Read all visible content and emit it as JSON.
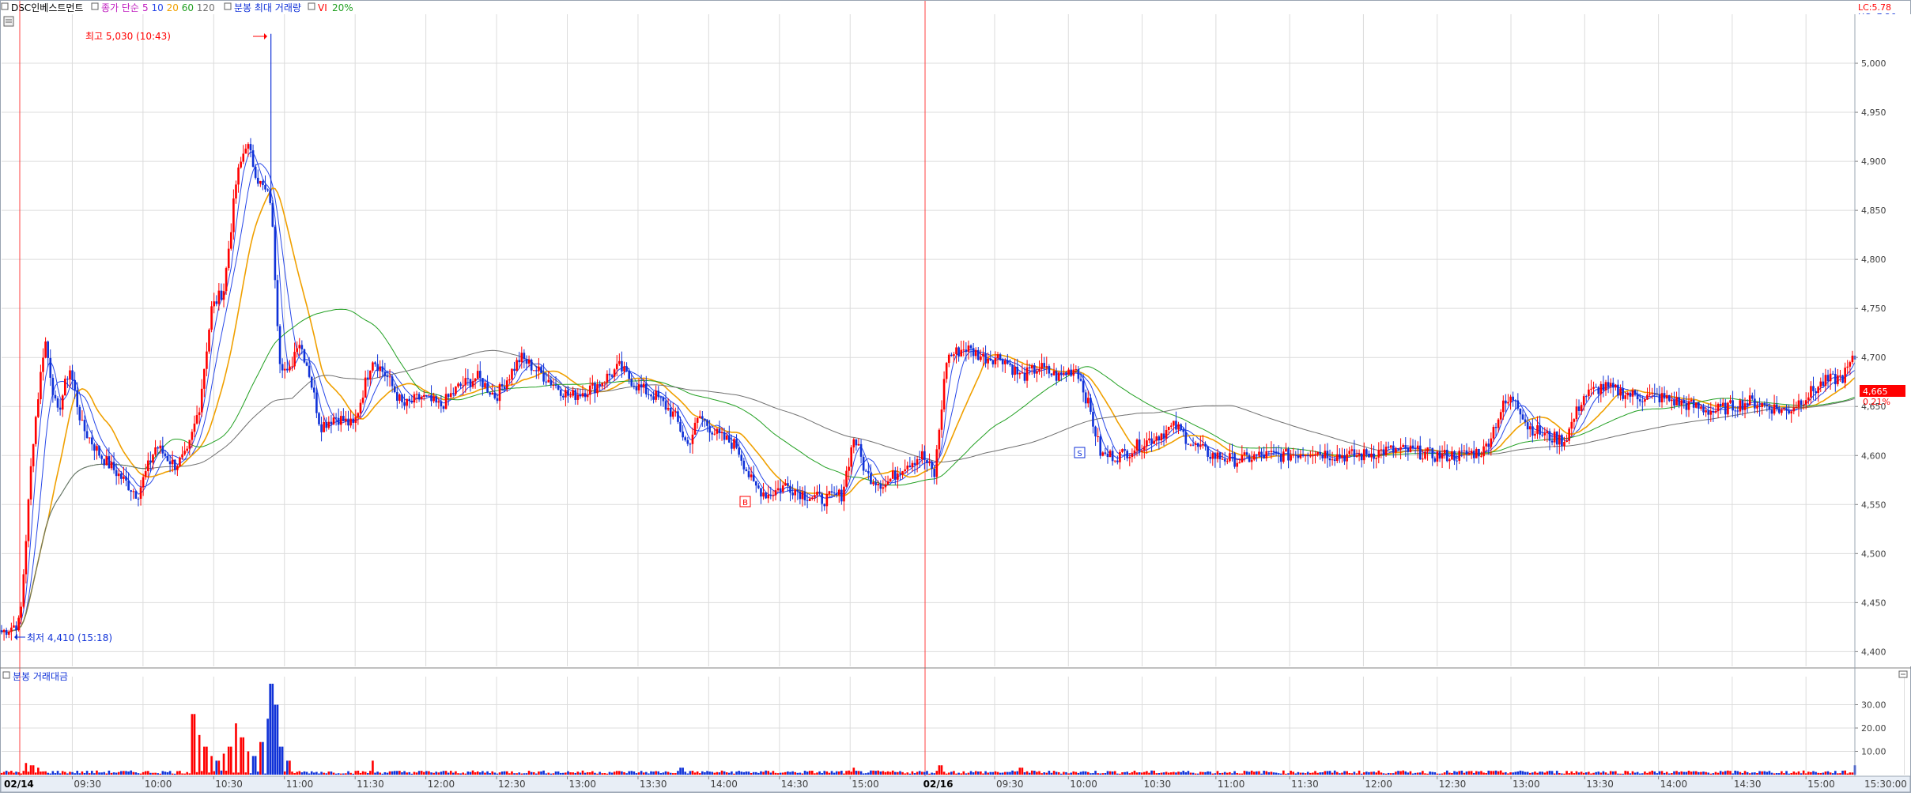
{
  "header": {
    "stock_name": "DSC인베스트먼트",
    "ma_label": "종가 단순",
    "ma_periods": [
      "5",
      "10",
      "20",
      "60",
      "120"
    ],
    "volume_label": "분봉 최대 거래량",
    "vi_label": "VI",
    "vi_value": "20%"
  },
  "right_info": {
    "lc": "LC:5.78",
    "hc": "HC:-7.26"
  },
  "colors": {
    "up": "#ff0000",
    "down": "#1032d8",
    "ma5": "#2848e8",
    "ma10": "#2848e8",
    "ma20": "#f0a000",
    "ma60": "#22a022",
    "ma120": "#707070",
    "grid": "#dcdcdc",
    "axis_bg": "#e8eef6"
  },
  "price_panel": {
    "high_annotation": "최고 5,030 (10:43)",
    "low_annotation": "최저 4,410 (15:18)",
    "current_price": "4,665",
    "current_change": "0.21%",
    "markers": [
      "B",
      "S"
    ]
  },
  "volume_panel": {
    "title": "분봉 거래대금"
  },
  "chart_data": [
    {
      "type": "candlestick",
      "title": "",
      "x_ticks": [
        "02/14",
        "09:30",
        "10:00",
        "10:30",
        "11:00",
        "11:30",
        "12:00",
        "12:30",
        "13:00",
        "13:30",
        "14:00",
        "14:30",
        "15:00",
        "02/16",
        "09:30",
        "10:00",
        "10:30",
        "11:00",
        "11:30",
        "12:00",
        "12:30",
        "13:00",
        "13:30",
        "14:00",
        "14:30",
        "15:00",
        "15:30:00"
      ],
      "y_ticks": [
        "5,000",
        "4,950",
        "4,900",
        "4,850",
        "4,800",
        "4,750",
        "4,700",
        "4,650",
        "4,600",
        "4,550",
        "4,500",
        "4,450",
        "4,400"
      ],
      "ylim": [
        4385,
        5050
      ],
      "grid": true,
      "price_path": [
        [
          0,
          4420
        ],
        [
          15,
          4430
        ],
        [
          25,
          4610
        ],
        [
          35,
          4720
        ],
        [
          45,
          4640
        ],
        [
          55,
          4690
        ],
        [
          65,
          4630
        ],
        [
          80,
          4600
        ],
        [
          95,
          4580
        ],
        [
          110,
          4560
        ],
        [
          125,
          4610
        ],
        [
          140,
          4590
        ],
        [
          150,
          4600
        ],
        [
          160,
          4650
        ],
        [
          170,
          4750
        ],
        [
          180,
          4770
        ],
        [
          190,
          4880
        ],
        [
          198,
          4920
        ],
        [
          208,
          4880
        ],
        [
          218,
          4860
        ],
        [
          225,
          4700
        ],
        [
          232,
          4680
        ],
        [
          240,
          4720
        ],
        [
          248,
          4690
        ],
        [
          258,
          4630
        ],
        [
          270,
          4640
        ],
        [
          285,
          4630
        ],
        [
          300,
          4700
        ],
        [
          312,
          4680
        ],
        [
          325,
          4650
        ],
        [
          340,
          4660
        ],
        [
          355,
          4650
        ],
        [
          370,
          4670
        ],
        [
          385,
          4680
        ],
        [
          400,
          4660
        ],
        [
          420,
          4700
        ],
        [
          440,
          4680
        ],
        [
          460,
          4660
        ],
        [
          480,
          4670
        ],
        [
          500,
          4690
        ],
        [
          515,
          4670
        ],
        [
          530,
          4660
        ],
        [
          545,
          4640
        ],
        [
          555,
          4610
        ],
        [
          565,
          4640
        ],
        [
          580,
          4620
        ],
        [
          595,
          4610
        ],
        [
          608,
          4570
        ],
        [
          620,
          4560
        ],
        [
          635,
          4570
        ],
        [
          650,
          4560
        ],
        [
          665,
          4555
        ],
        [
          680,
          4560
        ],
        [
          690,
          4620
        ],
        [
          700,
          4580
        ],
        [
          715,
          4570
        ],
        [
          730,
          4590
        ],
        [
          745,
          4600
        ],
        [
          755,
          4580
        ],
        [
          765,
          4700
        ],
        [
          780,
          4710
        ],
        [
          795,
          4700
        ],
        [
          810,
          4700
        ],
        [
          825,
          4680
        ],
        [
          840,
          4690
        ],
        [
          855,
          4680
        ],
        [
          870,
          4690
        ],
        [
          880,
          4650
        ],
        [
          890,
          4600
        ],
        [
          905,
          4600
        ],
        [
          920,
          4610
        ],
        [
          935,
          4620
        ],
        [
          950,
          4630
        ],
        [
          965,
          4610
        ],
        [
          980,
          4600
        ],
        [
          1000,
          4595
        ],
        [
          1020,
          4600
        ],
        [
          1040,
          4600
        ],
        [
          1060,
          4605
        ],
        [
          1080,
          4600
        ],
        [
          1100,
          4600
        ],
        [
          1120,
          4605
        ],
        [
          1140,
          4605
        ],
        [
          1160,
          4600
        ],
        [
          1180,
          4600
        ],
        [
          1200,
          4605
        ],
        [
          1215,
          4650
        ],
        [
          1225,
          4660
        ],
        [
          1235,
          4630
        ],
        [
          1250,
          4620
        ],
        [
          1265,
          4615
        ],
        [
          1280,
          4660
        ],
        [
          1295,
          4670
        ],
        [
          1310,
          4665
        ],
        [
          1325,
          4660
        ],
        [
          1340,
          4660
        ],
        [
          1355,
          4655
        ],
        [
          1370,
          4650
        ],
        [
          1385,
          4645
        ],
        [
          1400,
          4650
        ],
        [
          1415,
          4655
        ],
        [
          1430,
          4650
        ],
        [
          1445,
          4645
        ],
        [
          1460,
          4660
        ],
        [
          1475,
          4675
        ],
        [
          1490,
          4680
        ],
        [
          1500,
          4700
        ]
      ],
      "annotations": [
        "최고 5,030 (10:43)",
        "최저 4,410 (15:18)"
      ]
    },
    {
      "type": "bar",
      "title": "분봉 거래대금",
      "y_ticks": [
        "30.00",
        "20.00",
        "10.00"
      ],
      "ylim": [
        0,
        40
      ],
      "volume_spikes": [
        [
          20,
          5
        ],
        [
          25,
          4
        ],
        [
          30,
          3
        ],
        [
          155,
          26
        ],
        [
          160,
          17
        ],
        [
          165,
          12
        ],
        [
          170,
          8
        ],
        [
          175,
          6
        ],
        [
          180,
          9
        ],
        [
          185,
          12
        ],
        [
          190,
          22
        ],
        [
          195,
          16
        ],
        [
          200,
          10
        ],
        [
          205,
          8
        ],
        [
          210,
          14
        ],
        [
          215,
          24
        ],
        [
          218,
          39
        ],
        [
          222,
          30
        ],
        [
          226,
          12
        ],
        [
          232,
          6
        ],
        [
          300,
          6
        ],
        [
          550,
          3
        ],
        [
          690,
          3
        ],
        [
          760,
          4
        ],
        [
          825,
          3
        ],
        [
          1500,
          4
        ]
      ]
    }
  ]
}
